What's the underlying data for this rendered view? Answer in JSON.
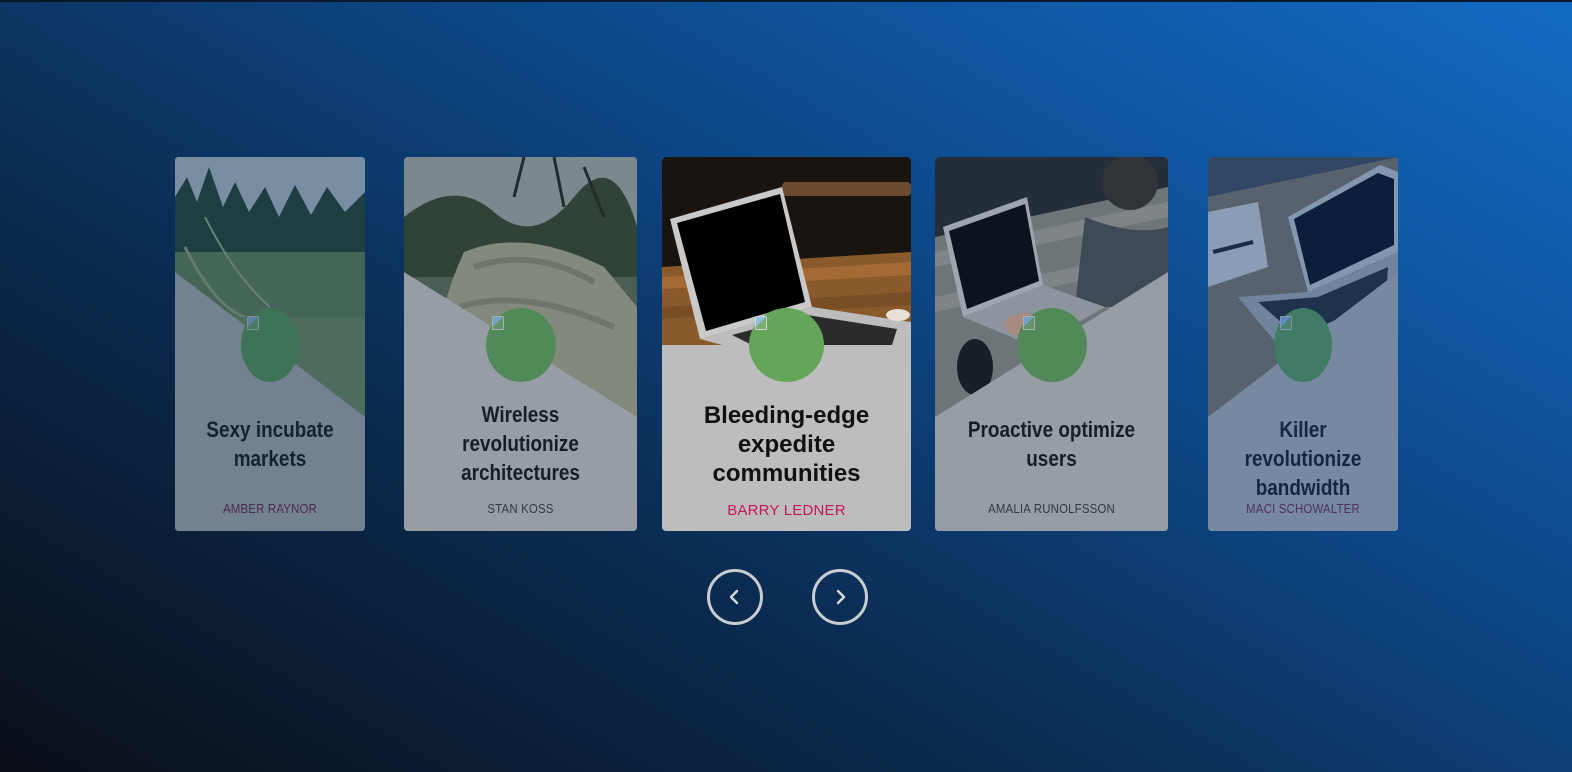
{
  "carousel": {
    "cards": [
      {
        "title_line1": "Sexy incubate",
        "title_line2": "markets",
        "title_line3": "",
        "author": "AMBER RAYNOR",
        "photo": "grass-field",
        "state": "far"
      },
      {
        "title_line1": "Wireless",
        "title_line2": "revolutionize",
        "title_line3": "architectures",
        "author": "STAN KOSS",
        "photo": "mossy-log",
        "state": "near"
      },
      {
        "title_line1": "Bleeding-edge",
        "title_line2": "expedite",
        "title_line3": "communities",
        "author": "BARRY LEDNER",
        "photo": "laptop-on-table",
        "state": "active"
      },
      {
        "title_line1": "Proactive optimize",
        "title_line2": "users",
        "title_line3": "",
        "author": "AMALIA RUNOLFSSON",
        "photo": "person-typing-laptop",
        "state": "near"
      },
      {
        "title_line1": "Killer revolutionize",
        "title_line2": "bandwidth",
        "title_line3": "",
        "author": "MACI SCHOWALTER",
        "photo": "laptop-desk-notebook",
        "state": "far"
      }
    ],
    "controls": {
      "prev_icon": "chevron-left-icon",
      "next_icon": "chevron-right-icon"
    }
  },
  "colors": {
    "avatar": "#64a55a",
    "active_author": "#c2185b",
    "side_author_far": "#7a2a4a",
    "side_author_near": "#3c3c3c",
    "button_ring": "#c9ccd1"
  }
}
